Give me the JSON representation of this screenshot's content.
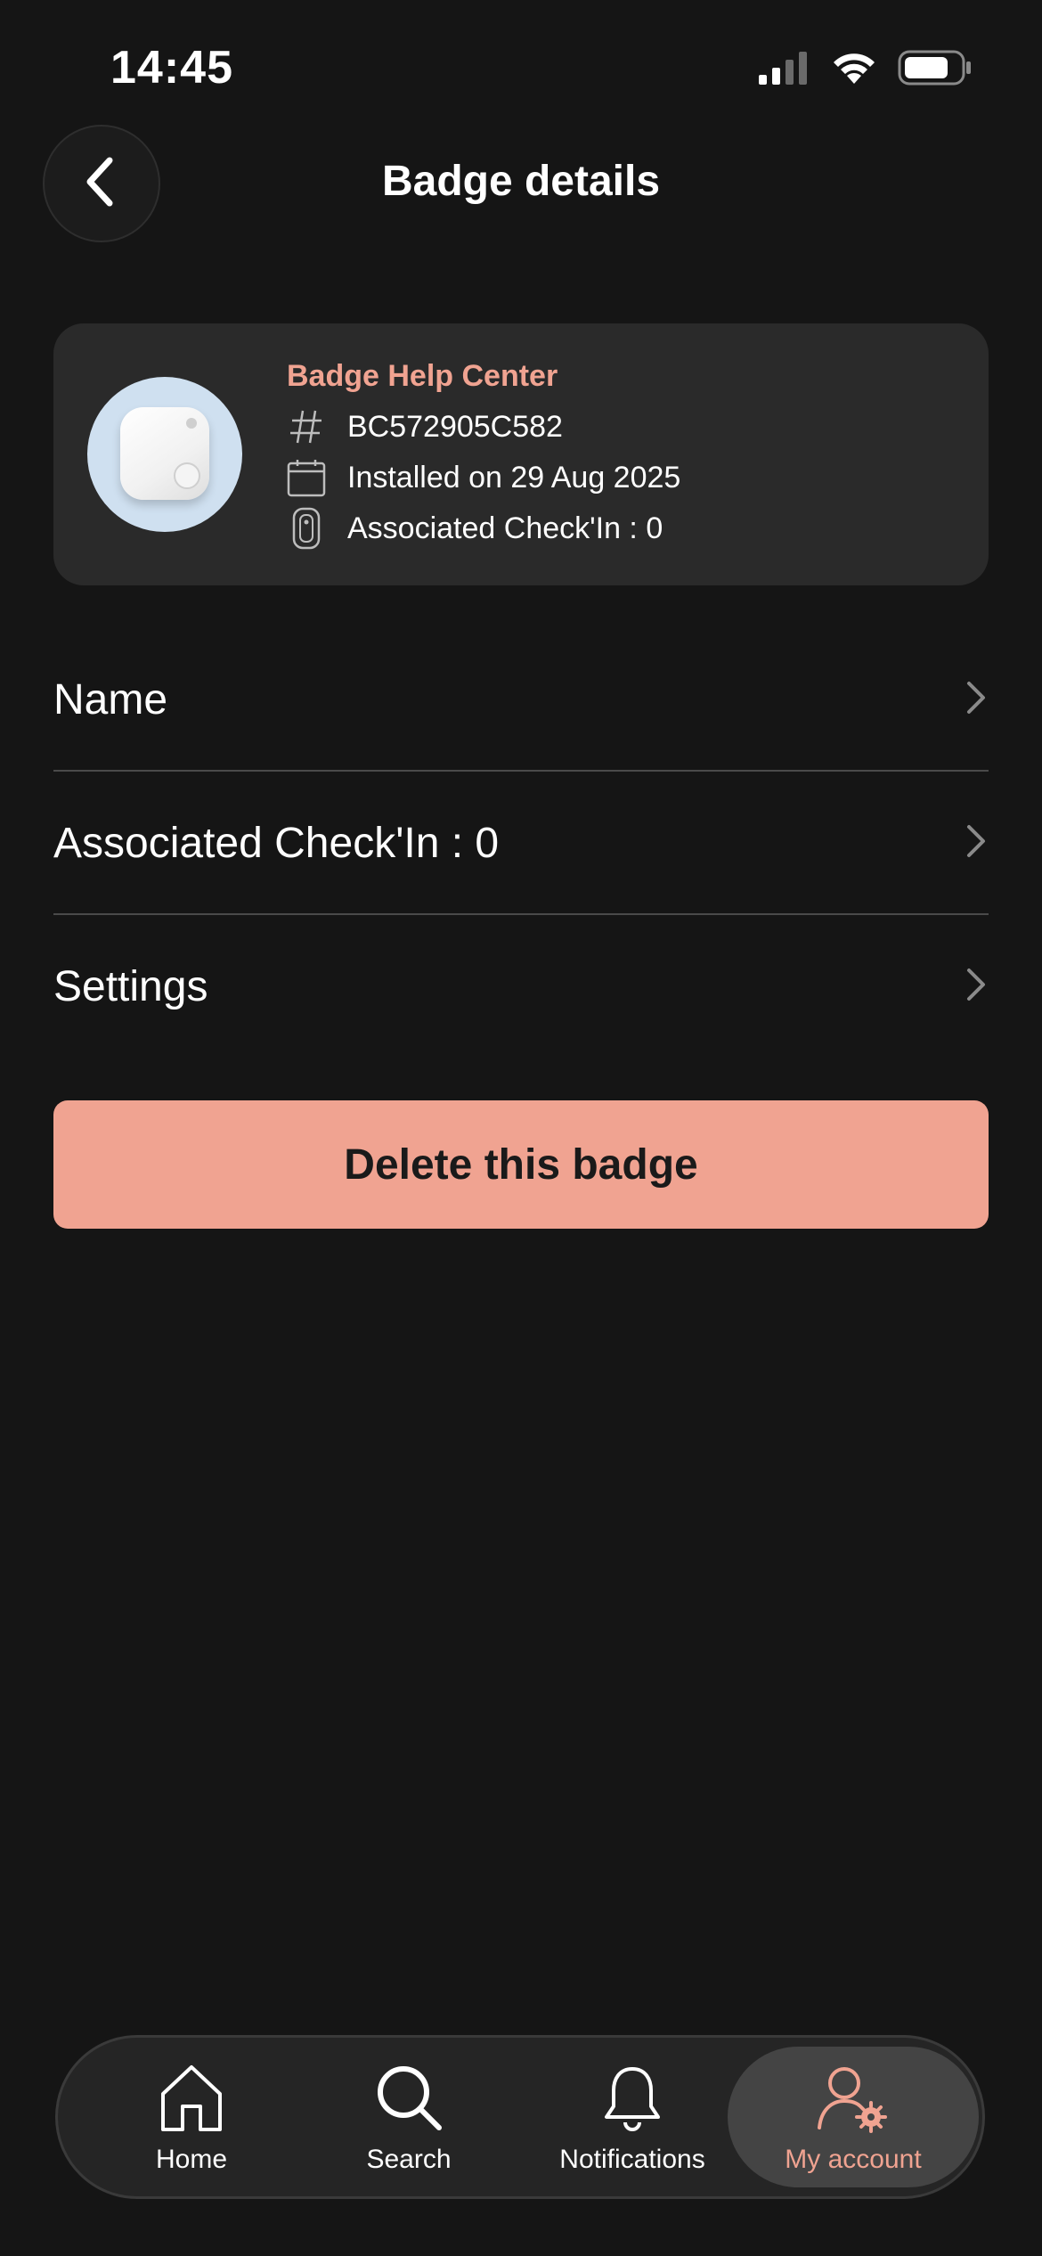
{
  "status_bar": {
    "time": "14:45",
    "icons": [
      "cellular-signal-icon",
      "wifi-icon",
      "battery-icon"
    ]
  },
  "header": {
    "title": "Badge details",
    "back_icon": "chevron-left-icon"
  },
  "badge_card": {
    "brand": "Badge Help Center",
    "serial": "BC572905C582",
    "installed": "Installed on 29 Aug 2025",
    "associated": "Associated Check'In : 0",
    "icons": [
      "hash-icon",
      "calendar-icon",
      "badge-device-icon"
    ]
  },
  "menu": {
    "items": [
      {
        "label": "Name"
      },
      {
        "label": "Associated Check'In : 0"
      },
      {
        "label": "Settings"
      }
    ]
  },
  "actions": {
    "delete_label": "Delete this badge"
  },
  "bottom_nav": {
    "items": [
      {
        "label": "Home",
        "icon": "home-icon"
      },
      {
        "label": "Search",
        "icon": "search-icon"
      },
      {
        "label": "Notifications",
        "icon": "bell-icon"
      },
      {
        "label": "My account",
        "icon": "account-settings-icon",
        "active": true
      }
    ]
  },
  "colors": {
    "background": "#151515",
    "card": "#2a2a2a",
    "accent": "#f0a391",
    "text": "#ffffff",
    "divider": "#4a4a4a"
  }
}
